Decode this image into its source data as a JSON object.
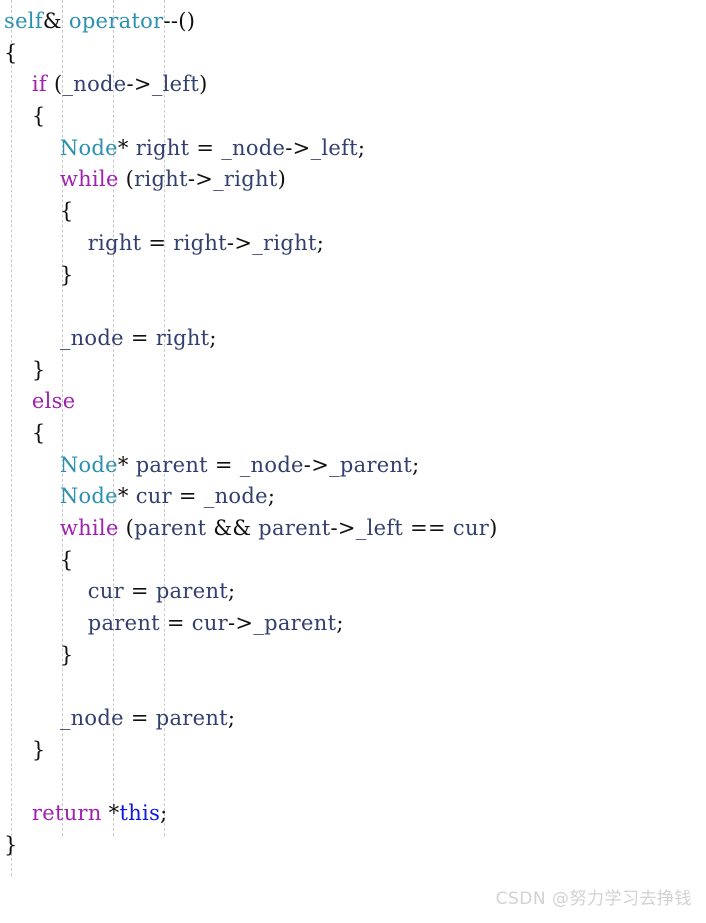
{
  "editor": {
    "language": "cpp",
    "background_color": "#ffffff",
    "indent_guide_color": "#c9c9c9",
    "font_size_px": 21,
    "line_height_px": 31.7,
    "colors": {
      "keyword": "#a020b0",
      "type": "#2b91af",
      "identifier": "#33406e",
      "this_keyword": "#0b17e8",
      "punctuation": "#101010"
    },
    "indent_guides_x": [
      11,
      62,
      113,
      164
    ],
    "lines": [
      {
        "indent": 0,
        "tokens": [
          {
            "t": "self",
            "c": "typ"
          },
          {
            "t": "& ",
            "c": "pun"
          },
          {
            "t": "operator",
            "c": "typ"
          },
          {
            "t": "--()",
            "c": "pun"
          }
        ]
      },
      {
        "indent": 0,
        "tokens": [
          {
            "t": "{",
            "c": "pun"
          }
        ]
      },
      {
        "indent": 1,
        "tokens": [
          {
            "t": "if",
            "c": "kw"
          },
          {
            "t": " (",
            "c": "pun"
          },
          {
            "t": "_node",
            "c": "id"
          },
          {
            "t": "->",
            "c": "pun"
          },
          {
            "t": "_left",
            "c": "id"
          },
          {
            "t": ")",
            "c": "pun"
          }
        ]
      },
      {
        "indent": 1,
        "tokens": [
          {
            "t": "{",
            "c": "pun"
          }
        ]
      },
      {
        "indent": 2,
        "tokens": [
          {
            "t": "Node",
            "c": "typ"
          },
          {
            "t": "* ",
            "c": "pun"
          },
          {
            "t": "right",
            "c": "id"
          },
          {
            "t": " = ",
            "c": "pun"
          },
          {
            "t": "_node",
            "c": "id"
          },
          {
            "t": "->",
            "c": "pun"
          },
          {
            "t": "_left",
            "c": "id"
          },
          {
            "t": ";",
            "c": "pun"
          }
        ]
      },
      {
        "indent": 2,
        "tokens": [
          {
            "t": "while",
            "c": "kw"
          },
          {
            "t": " (",
            "c": "pun"
          },
          {
            "t": "right",
            "c": "id"
          },
          {
            "t": "->",
            "c": "pun"
          },
          {
            "t": "_right",
            "c": "id"
          },
          {
            "t": ")",
            "c": "pun"
          }
        ]
      },
      {
        "indent": 2,
        "tokens": [
          {
            "t": "{",
            "c": "pun"
          }
        ]
      },
      {
        "indent": 3,
        "tokens": [
          {
            "t": "right",
            "c": "id"
          },
          {
            "t": " = ",
            "c": "pun"
          },
          {
            "t": "right",
            "c": "id"
          },
          {
            "t": "->",
            "c": "pun"
          },
          {
            "t": "_right",
            "c": "id"
          },
          {
            "t": ";",
            "c": "pun"
          }
        ]
      },
      {
        "indent": 2,
        "tokens": [
          {
            "t": "}",
            "c": "pun"
          }
        ]
      },
      {
        "indent": 0,
        "tokens": []
      },
      {
        "indent": 2,
        "tokens": [
          {
            "t": "_node",
            "c": "id"
          },
          {
            "t": " = ",
            "c": "pun"
          },
          {
            "t": "right",
            "c": "id"
          },
          {
            "t": ";",
            "c": "pun"
          }
        ]
      },
      {
        "indent": 1,
        "tokens": [
          {
            "t": "}",
            "c": "pun"
          }
        ]
      },
      {
        "indent": 1,
        "tokens": [
          {
            "t": "else",
            "c": "kw"
          }
        ]
      },
      {
        "indent": 1,
        "tokens": [
          {
            "t": "{",
            "c": "pun"
          }
        ]
      },
      {
        "indent": 2,
        "tokens": [
          {
            "t": "Node",
            "c": "typ"
          },
          {
            "t": "* ",
            "c": "pun"
          },
          {
            "t": "parent",
            "c": "id"
          },
          {
            "t": " = ",
            "c": "pun"
          },
          {
            "t": "_node",
            "c": "id"
          },
          {
            "t": "->",
            "c": "pun"
          },
          {
            "t": "_parent",
            "c": "id"
          },
          {
            "t": ";",
            "c": "pun"
          }
        ]
      },
      {
        "indent": 2,
        "tokens": [
          {
            "t": "Node",
            "c": "typ"
          },
          {
            "t": "* ",
            "c": "pun"
          },
          {
            "t": "cur",
            "c": "id"
          },
          {
            "t": " = ",
            "c": "pun"
          },
          {
            "t": "_node",
            "c": "id"
          },
          {
            "t": ";",
            "c": "pun"
          }
        ]
      },
      {
        "indent": 2,
        "tokens": [
          {
            "t": "while",
            "c": "kw"
          },
          {
            "t": " (",
            "c": "pun"
          },
          {
            "t": "parent",
            "c": "id"
          },
          {
            "t": " && ",
            "c": "pun"
          },
          {
            "t": "parent",
            "c": "id"
          },
          {
            "t": "->",
            "c": "pun"
          },
          {
            "t": "_left",
            "c": "id"
          },
          {
            "t": " == ",
            "c": "pun"
          },
          {
            "t": "cur",
            "c": "id"
          },
          {
            "t": ")",
            "c": "pun"
          }
        ]
      },
      {
        "indent": 2,
        "tokens": [
          {
            "t": "{",
            "c": "pun"
          }
        ]
      },
      {
        "indent": 3,
        "tokens": [
          {
            "t": "cur",
            "c": "id"
          },
          {
            "t": " = ",
            "c": "pun"
          },
          {
            "t": "parent",
            "c": "id"
          },
          {
            "t": ";",
            "c": "pun"
          }
        ]
      },
      {
        "indent": 3,
        "tokens": [
          {
            "t": "parent",
            "c": "id"
          },
          {
            "t": " = ",
            "c": "pun"
          },
          {
            "t": "cur",
            "c": "id"
          },
          {
            "t": "->",
            "c": "pun"
          },
          {
            "t": "_parent",
            "c": "id"
          },
          {
            "t": ";",
            "c": "pun"
          }
        ]
      },
      {
        "indent": 2,
        "tokens": [
          {
            "t": "}",
            "c": "pun"
          }
        ]
      },
      {
        "indent": 0,
        "tokens": []
      },
      {
        "indent": 2,
        "tokens": [
          {
            "t": "_node",
            "c": "id"
          },
          {
            "t": " = ",
            "c": "pun"
          },
          {
            "t": "parent",
            "c": "id"
          },
          {
            "t": ";",
            "c": "pun"
          }
        ]
      },
      {
        "indent": 1,
        "tokens": [
          {
            "t": "}",
            "c": "pun"
          }
        ]
      },
      {
        "indent": 0,
        "tokens": []
      },
      {
        "indent": 1,
        "tokens": [
          {
            "t": "return",
            "c": "kw"
          },
          {
            "t": " *",
            "c": "pun"
          },
          {
            "t": "this",
            "c": "this"
          },
          {
            "t": ";",
            "c": "pun"
          }
        ]
      },
      {
        "indent": 0,
        "tokens": [
          {
            "t": "}",
            "c": "pun"
          }
        ]
      }
    ]
  },
  "watermark": {
    "text": "CSDN @努力学习去挣钱"
  }
}
